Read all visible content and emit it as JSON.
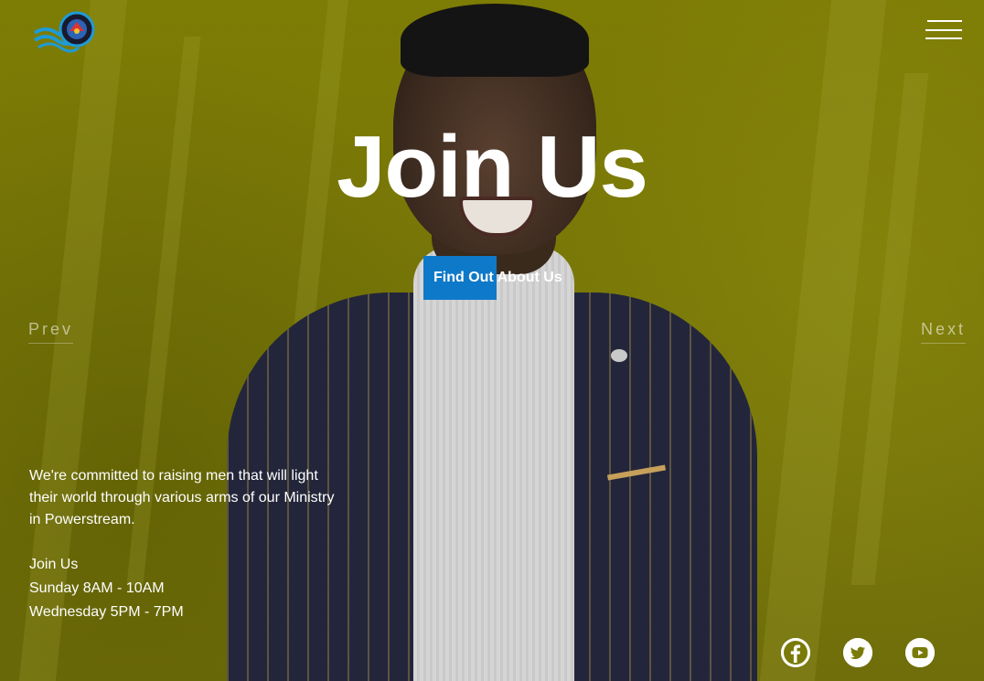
{
  "header": {
    "logo_icon": "ministry-logo",
    "menu_icon": "hamburger-menu-icon"
  },
  "hero": {
    "title": "Join Us",
    "cta_label": "Find Out About Us",
    "prev_label": "Prev",
    "next_label": "Next"
  },
  "info": {
    "intro": "We're committed to raising men that will light their world through various arms of our Ministry in Powerstream.",
    "schedule_title": "Join Us",
    "schedule_items": [
      "Sunday 8AM - 10AM",
      "Wednesday 5PM - 7PM"
    ]
  },
  "social": [
    {
      "icon": "facebook-icon"
    },
    {
      "icon": "twitter-icon"
    },
    {
      "icon": "youtube-icon"
    }
  ],
  "colors": {
    "overlay": "#7a7a08",
    "accent_button": "#0e79c8",
    "text": "#ffffff"
  }
}
